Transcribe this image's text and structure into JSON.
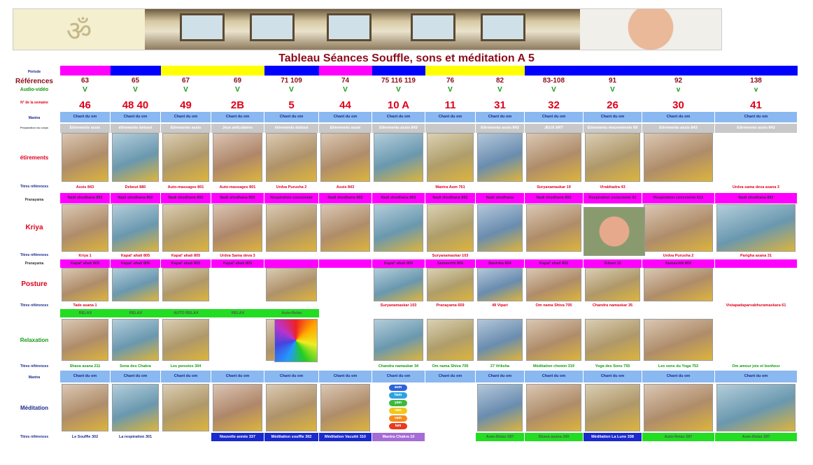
{
  "banner": {
    "logo_glyph": "ॐ"
  },
  "title": "Tableau Séances Souffle, sons et méditation A 5",
  "row_labels": {
    "periode": "Période",
    "references": "Références",
    "audio_video": "Audio-vidéo",
    "semaine": "N° de la semaine",
    "mantra": "Mantra",
    "preparation": "Préparation du corps",
    "etirements": "étirements",
    "titres1": "Titres références",
    "pranayama1": "Pranayama",
    "kriya": "Kriya",
    "titres2": "Titres références",
    "pranayama2": "Pranayama",
    "posture": "Posture",
    "titres3": "Titres références",
    "relaxation": "Relaxation",
    "titres4": "Titres références",
    "mantra2": "Mantra",
    "meditation": "Méditation",
    "titres5": "Titres références"
  },
  "periode_colors": [
    "#ff00ff",
    "#0000ff",
    "#ffff00",
    "#ffff00",
    "#0000ff",
    "#ff00ff",
    "#0000ff",
    "#ffff00",
    "#ffff00",
    "#0000ff",
    "#0000ff",
    "#0000ff",
    "#0000ff"
  ],
  "references": [
    "63",
    "65",
    "67",
    "69",
    "71 109",
    "74",
    "75 116  119",
    "76",
    "82",
    "83-108",
    "91",
    "92",
    "138"
  ],
  "audio": [
    "V",
    "V",
    "V",
    "V",
    "V",
    "V",
    "V",
    "V",
    "V",
    "V",
    "V",
    "v",
    "v"
  ],
  "semaines": [
    "46",
    "48 40",
    "49",
    "2B",
    "5",
    "44",
    "10 A",
    "11",
    "31",
    "32",
    "26",
    "30",
    "41"
  ],
  "mantra": "Chant du om",
  "preparation": [
    "Etirements assis",
    "étirements debout",
    "Etirements assis",
    "Jeux articulaires",
    "étirements debout",
    "Etirements assis",
    "Etirements assis 843",
    "",
    "Etirements assis 843",
    "JEUX ART",
    "Etirements mouvements 89",
    "Etirements assis 843",
    "Etirements assis 843"
  ],
  "titres1": [
    "Assis 843",
    "Debout 880",
    "Auto-massages 801",
    "Auto-massages 801",
    "Urdva Purusha 2",
    "Assis 843",
    "",
    "Mantra Aum 761",
    "",
    "Suryanamaskar 19",
    "Virabhadra 43",
    "",
    "Urdva sama deva asana 3"
  ],
  "pranayama1": [
    "Nadi shodhana 892",
    "Nadi shodhana 892",
    "Nadi shodhana 892",
    "Nadi shodhana 892",
    "Respiration consciente",
    "Nadi shodhana 892",
    "Nadi shodhana 892",
    "Nadi shodhana 892",
    "Nadi shodhana",
    "Nadi shodhana 892",
    "Respiration consciente 61",
    "Respiration consciente 612",
    "Nadi shodhana 892"
  ],
  "titres2": [
    "Kriya 1",
    "Kapal' ahati 805",
    "Kapal' ahati 805",
    "Urdva Sama deva 3",
    "",
    "",
    "",
    "Suryanamaskar 103",
    "",
    "",
    "",
    "Urdva Purusha 2",
    "Parigha asana 31"
  ],
  "pranayama2": [
    "Kapal' ahati 805",
    "Kapal' ahati 805",
    "Kapal' ahati 805",
    "Kapal' ahati 805",
    "",
    "",
    "Kapal' ahati 805",
    "Samavritti 806",
    "Bastrika 804",
    "Kapal' ahati 805",
    "Sitkari 15",
    "Samavritti 806",
    ""
  ],
  "titres3": [
    "Tade asana 1",
    "",
    "",
    "",
    "",
    "",
    "Suryanamaskar 103",
    "Pranayama 659",
    "49 Vipari",
    "Om nama Shiva 705",
    "Chandra namaskar 35",
    "",
    "Vistapadaparvabhuramaskara 61"
  ],
  "relax_bar": [
    "RELAX",
    "RELAX",
    "AUTO RELAX",
    "RELAX",
    "Auto-Relax"
  ],
  "titres4": [
    "Shava asana 211",
    "Sona des Chakra",
    "Les pensées 304",
    "",
    "",
    "",
    "Chandra namaskar 34",
    "Om nama Shiva 705",
    "27 Vriksha",
    "Méditation chemin 319",
    "Yoga des Sons 755",
    "Les sons du Yoga 753",
    "Om amour joie et bonheur"
  ],
  "titres5": [
    "Le Souffle 302",
    "La respiration 301",
    "",
    "Nouvelle année 337",
    "Méditation souffle 302",
    "Méditation Vacuité 310",
    "Mantra Chakra 10",
    "",
    "Auto-Relax 287",
    "Shava asana 290",
    "Méditation La Lune 338",
    "Auto-Relax 287",
    "Auto-Relax 287"
  ],
  "chakra_words": [
    "aum",
    "ham",
    "yam",
    "ram",
    "vam",
    "lam"
  ],
  "colors": {
    "title": "#8b0d1a",
    "red": "#e0001b",
    "green": "#169a16",
    "magenta": "#ff00ff",
    "mantra_bg": "#8ab8f0",
    "prep_bg": "#c8c8c8",
    "label_blue": "#1a2a8c"
  }
}
